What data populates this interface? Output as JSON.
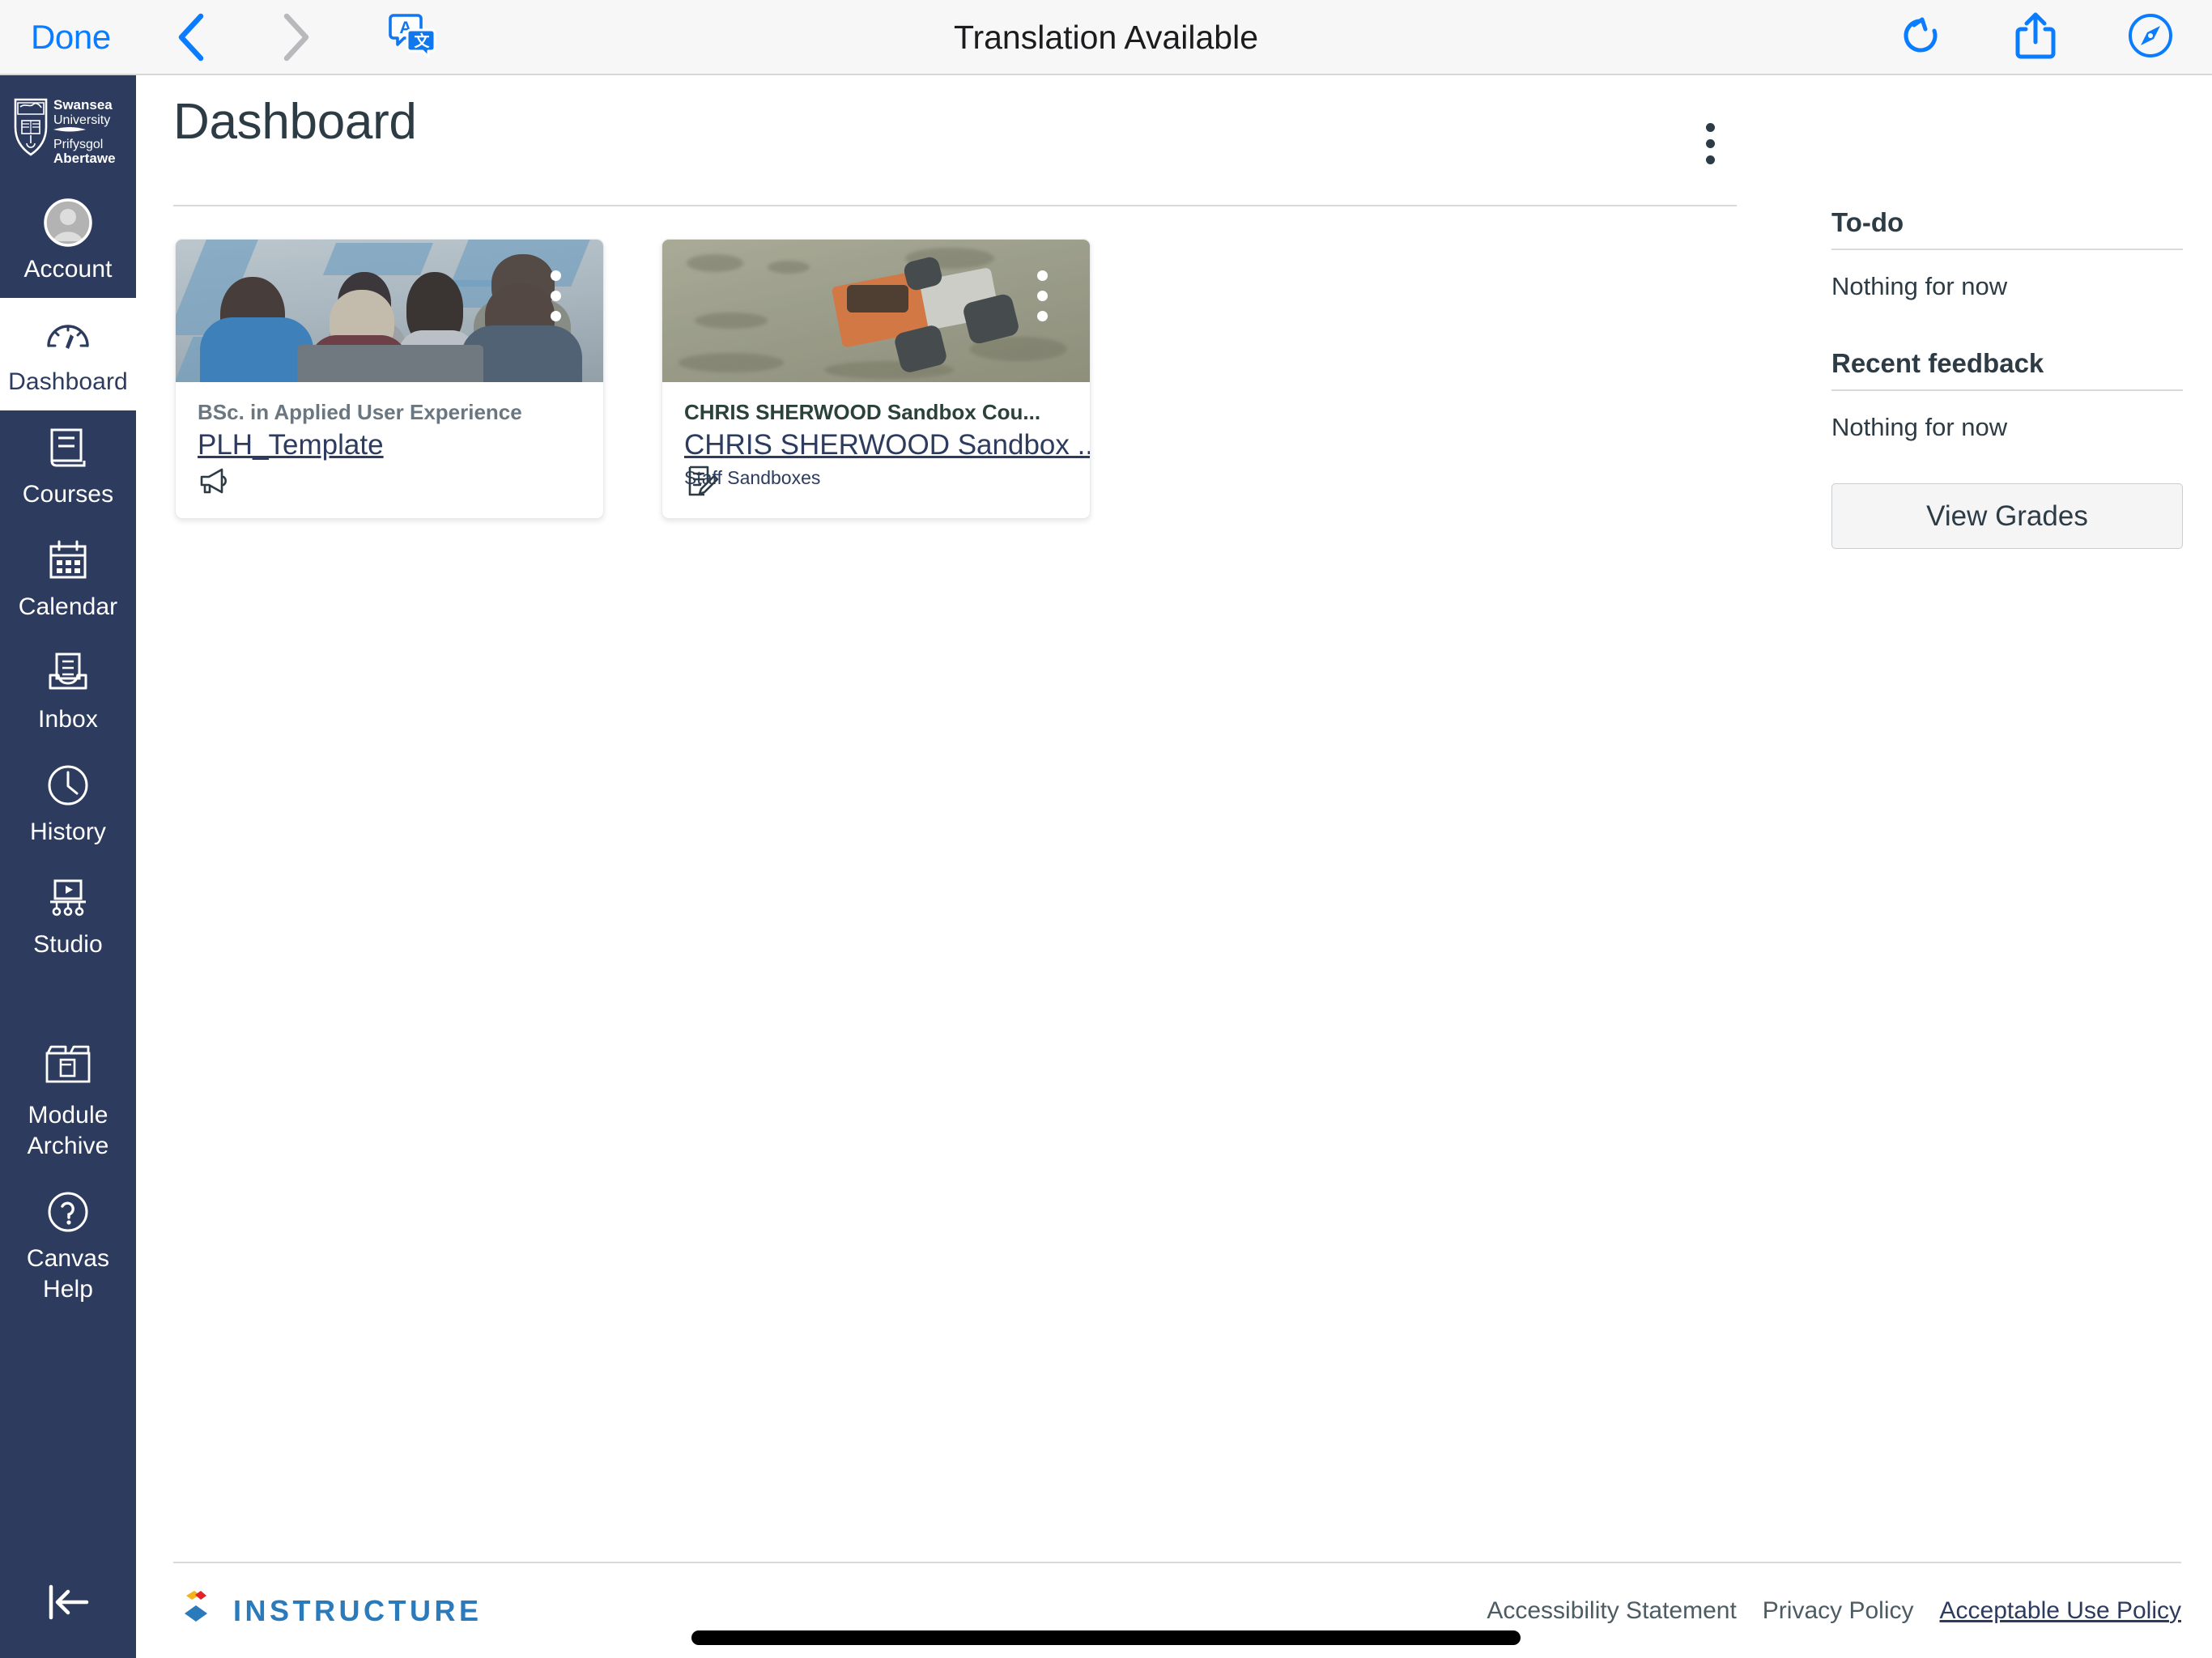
{
  "browser": {
    "done_label": "Done",
    "title": "Translation Available",
    "back_icon": "chevron-left-icon",
    "forward_icon": "chevron-right-icon",
    "translate_icon": "translate-icon",
    "reload_icon": "reload-icon",
    "share_icon": "share-icon",
    "compass_icon": "safari-compass-icon"
  },
  "global_nav": {
    "logo_alt": "Swansea University Prifysgol Abertawe",
    "logo_line1": "Swansea",
    "logo_line2": "University",
    "logo_line3": "Prifysgol",
    "logo_line4": "Abertawe",
    "collapse_icon": "collapse-sidebar-icon",
    "items": [
      {
        "label": "Account",
        "icon": "avatar-icon",
        "active": false
      },
      {
        "label": "Dashboard",
        "icon": "dashboard-gauge-icon",
        "active": true
      },
      {
        "label": "Courses",
        "icon": "book-icon",
        "active": false
      },
      {
        "label": "Calendar",
        "icon": "calendar-icon",
        "active": false
      },
      {
        "label": "Inbox",
        "icon": "inbox-tray-icon",
        "active": false
      },
      {
        "label": "History",
        "icon": "clock-icon",
        "active": false
      },
      {
        "label": "Studio",
        "icon": "studio-screen-icon",
        "active": false
      },
      {
        "label": "Module Archive",
        "icon": "archive-box-icon",
        "active": false
      },
      {
        "label": "Canvas Help",
        "icon": "question-circle-icon",
        "active": false
      }
    ]
  },
  "main": {
    "page_title": "Dashboard",
    "options_icon": "kebab-menu-icon",
    "cards": [
      {
        "term": "BSc. in Applied User Experience",
        "term_color": "#6b7780",
        "title": "PLH_Template",
        "subtitle": "",
        "image_alt": "group-of-people-at-laptop-photo",
        "kebab_icon": "kebab-menu-icon",
        "actions": [
          {
            "name": "announcements",
            "icon": "megaphone-icon"
          }
        ]
      },
      {
        "term": "CHRIS SHERWOOD Sandbox Cou...",
        "term_color": "#2a4239",
        "title": "CHRIS SHERWOOD Sandbox ...",
        "subtitle": "Staff Sandboxes",
        "image_alt": "orange-toy-truck-in-sand-photo",
        "kebab_icon": "kebab-menu-icon",
        "actions": [
          {
            "name": "assignments",
            "icon": "assignment-pencil-icon"
          }
        ]
      }
    ]
  },
  "right_sidebar": {
    "todo_heading": "To-do",
    "todo_empty": "Nothing for now",
    "feedback_heading": "Recent feedback",
    "feedback_empty": "Nothing for now",
    "view_grades_label": "View Grades"
  },
  "footer": {
    "wordmark": "INSTRUCTURE",
    "logo_icon": "instructure-diamonds-icon",
    "links": [
      {
        "label": "Accessibility Statement",
        "focused": false
      },
      {
        "label": "Privacy Policy",
        "focused": false
      },
      {
        "label": "Acceptable Use Policy",
        "focused": true
      }
    ]
  },
  "colors": {
    "nav_background": "#2d3b5e",
    "accent_blue": "#0a7cff",
    "link_navy": "#2d3b5e",
    "instructure_blue": "#2b7abc",
    "instructure_yellow": "#f6b319",
    "instructure_red": "#e0242a"
  }
}
